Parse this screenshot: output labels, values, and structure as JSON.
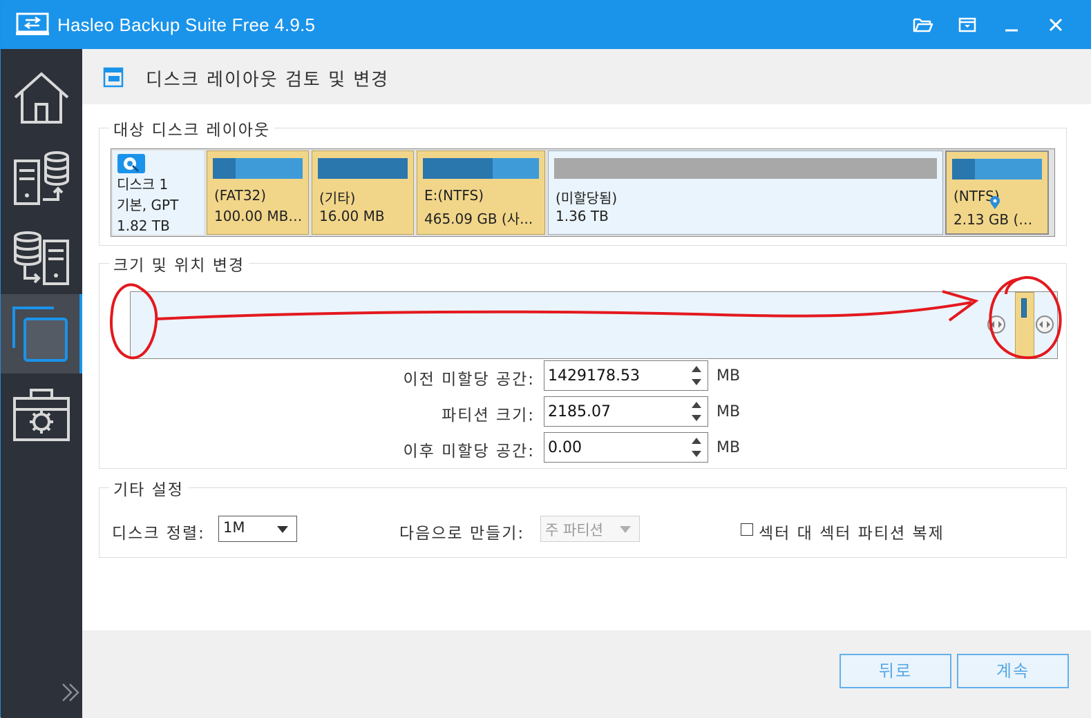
{
  "titlebar": {
    "title": "Hasleo Backup Suite Free 4.9.5",
    "buttons": [
      "folder-open",
      "restore",
      "minimize",
      "close"
    ]
  },
  "sidebar": {
    "items": [
      {
        "name": "home",
        "active": false
      },
      {
        "name": "backup",
        "active": false
      },
      {
        "name": "restore",
        "active": false
      },
      {
        "name": "clone",
        "active": true
      },
      {
        "name": "tools",
        "active": false
      }
    ],
    "expand_icon": "double-chevron-right-icon"
  },
  "header": {
    "title": "디스크 레이아웃 검토 및 변경"
  },
  "layout_group": {
    "label": "대상 디스크 레이아웃",
    "disk": {
      "name": "디스크 1",
      "type": "기본, GPT",
      "size": "1.82 TB"
    },
    "partitions": [
      {
        "line1": "(FAT32)",
        "line2": "100.00 MB ...",
        "used": 0.25,
        "kind": "partition"
      },
      {
        "line1": "(기타)",
        "line2": "16.00 MB",
        "used": 1.0,
        "kind": "partition"
      },
      {
        "line1": "E:(NTFS)",
        "line2": "465.09 GB (사...",
        "used": 0.6,
        "kind": "partition"
      },
      {
        "line1": "(미할당됨)",
        "line2": "1.36 TB",
        "used": 0,
        "kind": "unallocated"
      },
      {
        "line1": "(NTFS)",
        "line2": "2.13 GB (사...",
        "used": 0.25,
        "kind": "partition"
      }
    ]
  },
  "resize_group": {
    "label": "크기 및 위치 변경",
    "before_label": "이전 미할당 공간:",
    "before_value": "1429178.53",
    "size_label": "파티션 크기:",
    "size_value": "2185.07",
    "after_label": "이후 미할당 공간:",
    "after_value": "0.00",
    "unit": "MB"
  },
  "other_group": {
    "label": "기타 설정",
    "align_label": "디스크 정렬:",
    "align_value": "1M",
    "create_label": "다음으로 만들기:",
    "create_value": "주 파티션",
    "sector_label": "섹터 대 섹터 파티션 복제",
    "sector_checked": false
  },
  "footer": {
    "back": "뒤로",
    "next": "계속"
  },
  "colors": {
    "accent": "#1a93ea",
    "sidebar": "#2d3139",
    "partition": "#f1d68a",
    "annotation": "#e3191e"
  }
}
